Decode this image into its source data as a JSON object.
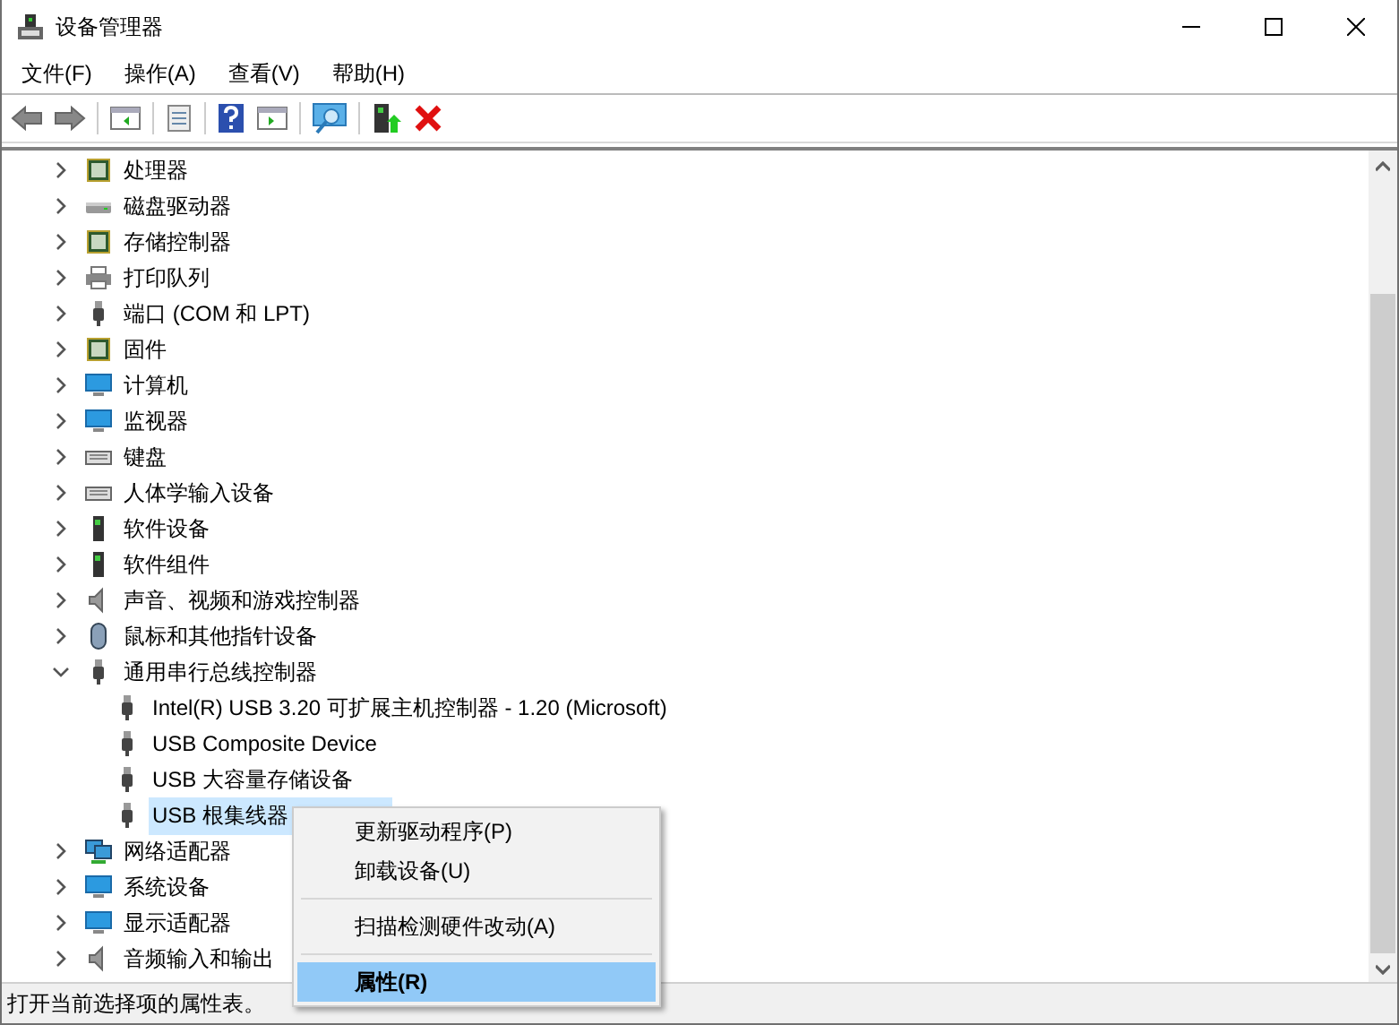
{
  "window": {
    "title": "设备管理器"
  },
  "menu_bar": [
    "文件(F)",
    "操作(A)",
    "查看(V)",
    "帮助(H)"
  ],
  "tree": {
    "items": [
      {
        "label": "处理器",
        "expanded": false,
        "selected": false
      },
      {
        "label": "磁盘驱动器",
        "expanded": false,
        "selected": false
      },
      {
        "label": "存储控制器",
        "expanded": false,
        "selected": false
      },
      {
        "label": "打印队列",
        "expanded": false,
        "selected": false
      },
      {
        "label": "端口 (COM 和 LPT)",
        "expanded": false,
        "selected": false
      },
      {
        "label": "固件",
        "expanded": false,
        "selected": false
      },
      {
        "label": "计算机",
        "expanded": false,
        "selected": false
      },
      {
        "label": "监视器",
        "expanded": false,
        "selected": false
      },
      {
        "label": "键盘",
        "expanded": false,
        "selected": false
      },
      {
        "label": "人体学输入设备",
        "expanded": false,
        "selected": false
      },
      {
        "label": "软件设备",
        "expanded": false,
        "selected": false
      },
      {
        "label": "软件组件",
        "expanded": false,
        "selected": false
      },
      {
        "label": "声音、视频和游戏控制器",
        "expanded": false,
        "selected": false
      },
      {
        "label": "鼠标和其他指针设备",
        "expanded": false,
        "selected": false
      },
      {
        "label": "通用串行总线控制器",
        "expanded": true,
        "selected": false,
        "children": [
          {
            "label": "Intel(R) USB 3.20 可扩展主机控制器 - 1.20 (Microsoft)",
            "selected": false
          },
          {
            "label": "USB Composite Device",
            "selected": false
          },
          {
            "label": "USB 大容量存储设备",
            "selected": false
          },
          {
            "label": "USB 根集线器",
            "selected": true
          }
        ]
      },
      {
        "label": "网络适配器",
        "expanded": false,
        "selected": false
      },
      {
        "label": "系统设备",
        "expanded": false,
        "selected": false
      },
      {
        "label": "显示适配器",
        "expanded": false,
        "selected": false
      },
      {
        "label": "音频输入和输出",
        "expanded": false,
        "selected": false
      }
    ]
  },
  "context_menu": {
    "items": [
      {
        "kind": "item",
        "label": "更新驱动程序(P)",
        "selected": false
      },
      {
        "kind": "item",
        "label": "卸载设备(U)",
        "selected": false
      },
      {
        "kind": "separator"
      },
      {
        "kind": "item",
        "label": "扫描检测硬件改动(A)",
        "selected": false
      },
      {
        "kind": "separator"
      },
      {
        "kind": "item",
        "label": "属性(R)",
        "selected": true
      }
    ]
  },
  "status_bar": "打开当前选择项的属性表。"
}
